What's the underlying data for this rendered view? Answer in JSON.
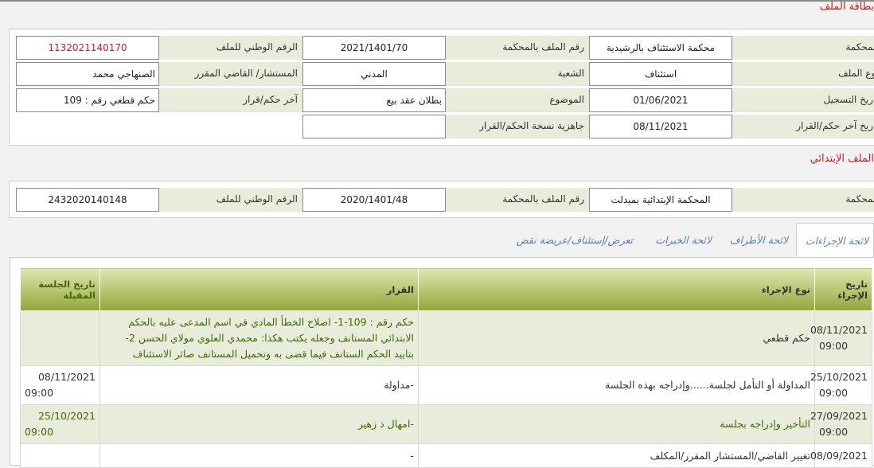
{
  "file_card": {
    "title": "بطاقة الملف",
    "court_label": "المحكمة",
    "court_value": "محكمة الاستئناف بالرشيدية",
    "court_file_label": "رقم الملف بالمحكمة",
    "court_file_value": "2021/1401/70",
    "national_label": "الرقم الوطني للملف",
    "national_value": "1132021140170",
    "type_label": "نوع الملف",
    "type_value": "استئناف",
    "branch_label": "الشعبة",
    "branch_value": "المدني",
    "judge_label": "المستشار/ القاضي المقرر",
    "judge_value": "الصنهاجي محمد",
    "reg_date_label": "تاريخ التسجيل",
    "reg_date_value": "01/06/2021",
    "subject_label": "الموضوع",
    "subject_value": "بطلان عقد بيع",
    "last_judgment_label": "آخر حكم/قرار",
    "last_judgment_value": "حكم قطعي رقم : 109",
    "last_judgment_date_label": "تاريخ آخر حكم/القرار",
    "last_judgment_date_value": "08/11/2021",
    "copy_ready_label": "جاهزية نسخة الحكم/القرار",
    "copy_ready_value": ""
  },
  "initial_file": {
    "title": "الملف الإبتدائي",
    "court_label": "المحكمة",
    "court_value": "المحكمة الإبتدائية بميدلت",
    "court_file_label": "رقم الملف بالمحكمة",
    "court_file_value": "2020/1401/48",
    "national_label": "الرقم الوطني للملف",
    "national_value": "2432020140148"
  },
  "tabs": [
    {
      "label": "لائحة الإجراءات"
    },
    {
      "label": "لائحة الأطراف"
    },
    {
      "label": "لائحة الخبرات"
    },
    {
      "label": "تعرض/إستئناف/عريضة نقض"
    }
  ],
  "procedures": {
    "headers": [
      "تاريخ الإجراء",
      "نوع الإجراء",
      "القرار",
      "تاريخ الجلسة المقبلة"
    ],
    "rows": [
      {
        "date": "08/11/2021",
        "time": "09:00",
        "type": "حكم قطعي",
        "decision": "حكم رقم : 109-1- اصلاح الخطأ المادي في اسم المدعى عليه بالحكم الابتدائي المستانف وجعله يكتب هكذا: محمدي العلوي مولاي الحسن 2- بتاييد الحكم الستانف فيما قضى به وتحميل المستانف صائر الاستئناف",
        "next_date": "",
        "next_time": ""
      },
      {
        "date": "25/10/2021",
        "time": "09:00",
        "type": "المداولة أو التأمل لجلسة......وإدراجه بهذه الجلسة",
        "decision": "-مداولة",
        "next_date": "08/11/2021",
        "next_time": "09:00"
      },
      {
        "date": "27/09/2021",
        "time": "09:00",
        "type": "التأخير وإدراجه بجلسة",
        "decision": "-امهال ذ زهير",
        "next_date": "25/10/2021",
        "next_time": "09:00"
      },
      {
        "date": "08/09/2021",
        "time": "",
        "type": "تغيير القاضي/المستشار المقرر/المكلف",
        "decision": "-",
        "next_date": "",
        "next_time": ""
      }
    ]
  }
}
